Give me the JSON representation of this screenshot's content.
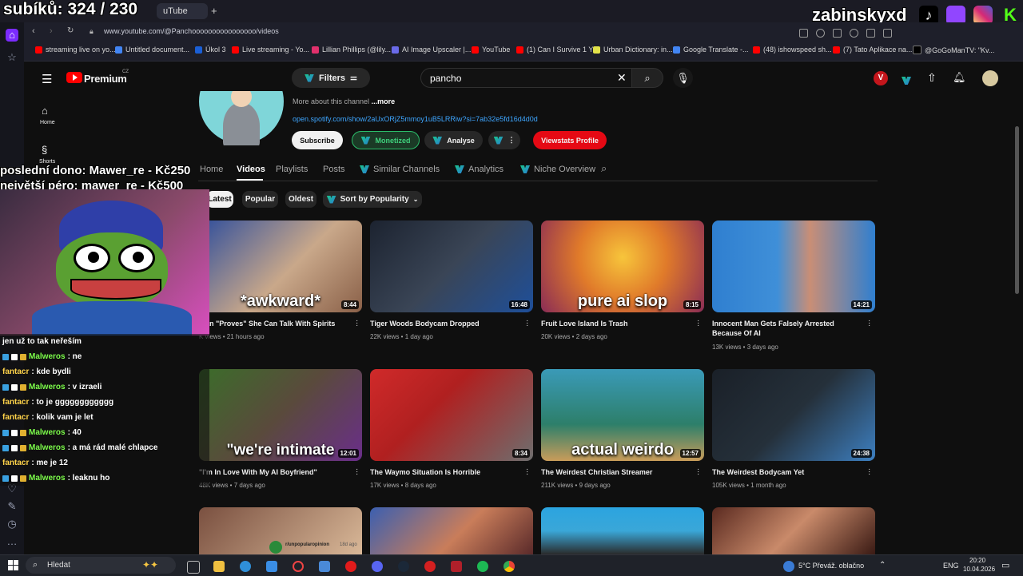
{
  "overlay": {
    "sub_counter": "subíků: 324 / 230",
    "streamer_name": "zabinskyxd",
    "last_dono": "poslední dono: Mawer_re - Kč250",
    "biggest_dono": "největší péro: mawer_re - Kč500",
    "chat_top": "jen už to tak neřeším",
    "chat": [
      {
        "user": "Malweros",
        "msg": ": ne",
        "color": "#7CFC4A",
        "badges": true
      },
      {
        "user": "fantacr",
        "msg": ": kde bydli",
        "color": "#ffd34a",
        "badges": false
      },
      {
        "user": "Malweros",
        "msg": ": v izraeli",
        "color": "#7CFC4A",
        "badges": true
      },
      {
        "user": "fantacr",
        "msg": ": to je gggggggggggg",
        "color": "#ffd34a",
        "badges": false
      },
      {
        "user": "fantacr",
        "msg": ": kolik vam je let",
        "color": "#ffd34a",
        "badges": false
      },
      {
        "user": "Malweros",
        "msg": ": 40",
        "color": "#7CFC4A",
        "badges": true
      },
      {
        "user": "Malweros",
        "msg": ": a má rád malé chlapce",
        "color": "#7CFC4A",
        "badges": true
      },
      {
        "user": "fantacr",
        "msg": ": me je 12",
        "color": "#ffd34a",
        "badges": false
      },
      {
        "user": "Malweros",
        "msg": ": leaknu ho",
        "color": "#7CFC4A",
        "badges": true
      }
    ]
  },
  "browser": {
    "tab_title": "uTube",
    "new_tab": "+",
    "url": "www.youtube.com/@Panchoooooooooooooooo/videos",
    "bookmarks": [
      "streaming live on yo...",
      "Untitled document...",
      "Úkol 3",
      "Live streaming - Yo...",
      "Lillian Phillips (@lily...",
      "AI Image Upscaler |...",
      "YouTube",
      "(1) Can I Survive 1 Y...",
      "Urban Dictionary: in...",
      "Google Translate -...",
      "(48) ishowspeed sh...",
      "(7) Tato Aplikace na...",
      "@GoGoManTV: \"Kv..."
    ]
  },
  "header": {
    "brand": "Premium",
    "region": "CZ",
    "filters_label": "Filters",
    "search_value": "pancho"
  },
  "guide": {
    "home": "Home",
    "shorts": "Shorts"
  },
  "channel": {
    "more_about": "More about this channel",
    "more_link": "...more",
    "link": "open.spotify.com/show/2aUxORjZ5mmoy1uB5LRRiw?si=7ab32e5fd16d4d0d",
    "subscribe": "Subscribe",
    "monetized": "Monetized",
    "analyse": "Analyse",
    "viewstats": "Viewstats Profile",
    "tabs": [
      "Home",
      "Videos",
      "Playlists",
      "Posts",
      "Similar Channels",
      "Analytics",
      "Niche Overview"
    ],
    "active_tab": "Videos"
  },
  "chips": {
    "latest": "Latest",
    "popular": "Popular",
    "oldest": "Oldest",
    "sort": "Sort by Popularity"
  },
  "videos": [
    {
      "title": "man \"Proves\" She Can Talk With Spirits",
      "meta": "K views • 21 hours ago",
      "duration": "8:44",
      "overlay": "*awkward*",
      "bg": "#c9a88a"
    },
    {
      "title": "Tiger Woods Bodycam Dropped",
      "meta": "22K views • 1 day ago",
      "duration": "16:48",
      "overlay": "",
      "bg": "#3a4556"
    },
    {
      "title": "Fruit Love Island Is Trash",
      "meta": "20K views • 2 days ago",
      "duration": "8:15",
      "overlay": "pure ai slop",
      "bg": "#e07a2a"
    },
    {
      "title": "Innocent Man Gets Falsely Arrested Because Of AI",
      "meta": "13K views • 3 days ago",
      "duration": "14:21",
      "overlay": "",
      "bg": "#3f8fd8"
    },
    {
      "title": "\"I'm In Love With My AI Boyfriend\"",
      "meta": "48K views • 7 days ago",
      "duration": "12:01",
      "overlay": "\"we're intimate",
      "bg": "#5a4a3c"
    },
    {
      "title": "The Waymo Situation Is Horrible",
      "meta": "17K views • 8 days ago",
      "duration": "8:34",
      "overlay": "",
      "bg": "#b02020"
    },
    {
      "title": "The Weirdest Christian Streamer",
      "meta": "211K views • 9 days ago",
      "duration": "12:57",
      "overlay": "actual weirdo",
      "bg": "#3a9ab8"
    },
    {
      "title": "The Weirdest Bodycam Yet",
      "meta": "105K views • 1 month ago",
      "duration": "24:38",
      "overlay": "",
      "bg": "#25303a"
    }
  ],
  "row3": {
    "post_user": "r/unpopularopinion",
    "post_time": "18d ago"
  },
  "taskbar": {
    "search": "Hledat",
    "weather": "5°C  Převáž. oblačno",
    "lang": "ENG",
    "time": "20:20",
    "date": "10.04.2026"
  }
}
